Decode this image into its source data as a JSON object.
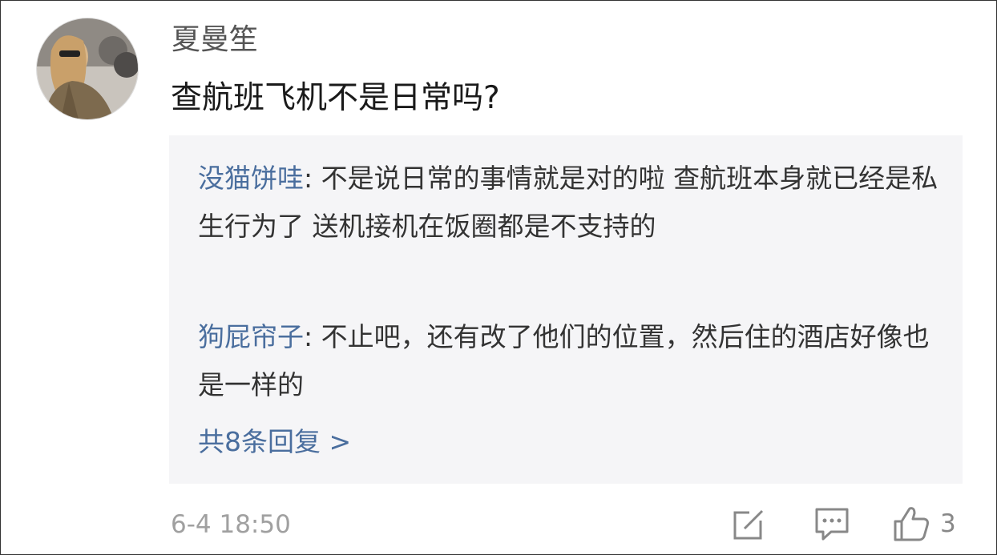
{
  "comment": {
    "author": "夏曼笙",
    "text": "查航班飞机不是日常吗?",
    "timestamp": "6-4 18:50",
    "like_count": "3"
  },
  "replies": [
    {
      "name": "没猫饼哇",
      "text": ": 不是说日常的事情就是对的啦 查航班本身就已经是私生行为了 送机接机在饭圈都是不支持的"
    },
    {
      "name": "狗屁帘子",
      "text": ": 不止吧，还有改了他们的位置，然后住的酒店好像也是一样的"
    }
  ],
  "more_replies_label": "共8条回复 >",
  "icons": {
    "edit": "edit-icon",
    "comment": "comment-icon",
    "like": "thumbs-up-icon"
  },
  "colors": {
    "link": "#4a6e9e",
    "reply_background": "#f5f5f7",
    "muted_text": "#a0a0a0"
  }
}
